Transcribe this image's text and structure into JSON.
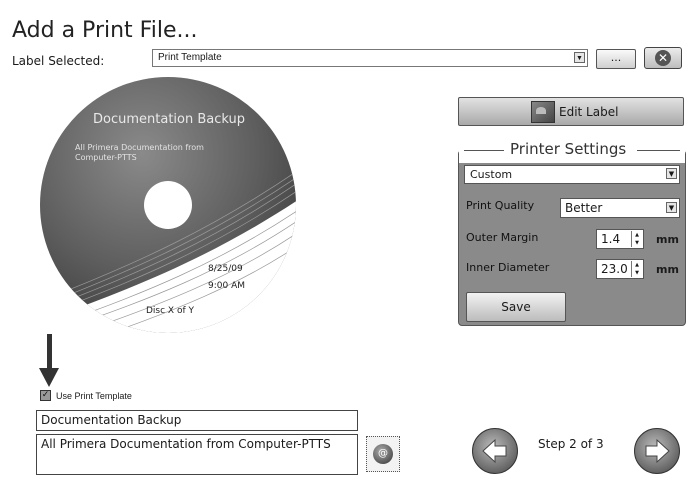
{
  "header": {
    "title": "Add a Print File..."
  },
  "label_selection": {
    "label": "Label Selected:",
    "selected_value": "Print Template",
    "browse_label": "...",
    "close_icon": "close-icon"
  },
  "disc_preview": {
    "title": "Documentation Backup",
    "subtitle": "All Primera Documentation from Computer-PTTS",
    "date": "8/25/09",
    "time": "9:00 AM",
    "disc_number": "Disc X of Y"
  },
  "edit_label": {
    "label": "Edit Label",
    "icon": "edit-label-icon"
  },
  "printer_settings": {
    "title": "Printer Settings",
    "preset_value": "Custom",
    "print_quality_label": "Print Quality",
    "print_quality_value": "Better",
    "outer_margin_label": "Outer Margin",
    "outer_margin_value": "1.4",
    "inner_diameter_label": "Inner Diameter",
    "inner_diameter_value": "23.0",
    "unit": "mm",
    "save_label": "Save"
  },
  "template_options": {
    "use_template_label": "Use Print Template",
    "use_template_checked": true,
    "title_value": "Documentation Backup",
    "description_value": "All Primera Documentation from Computer-PTTS"
  },
  "navigation": {
    "step_label": "Step 2 of 3",
    "back_icon": "back-arrow-icon",
    "next_icon": "next-arrow-icon"
  }
}
